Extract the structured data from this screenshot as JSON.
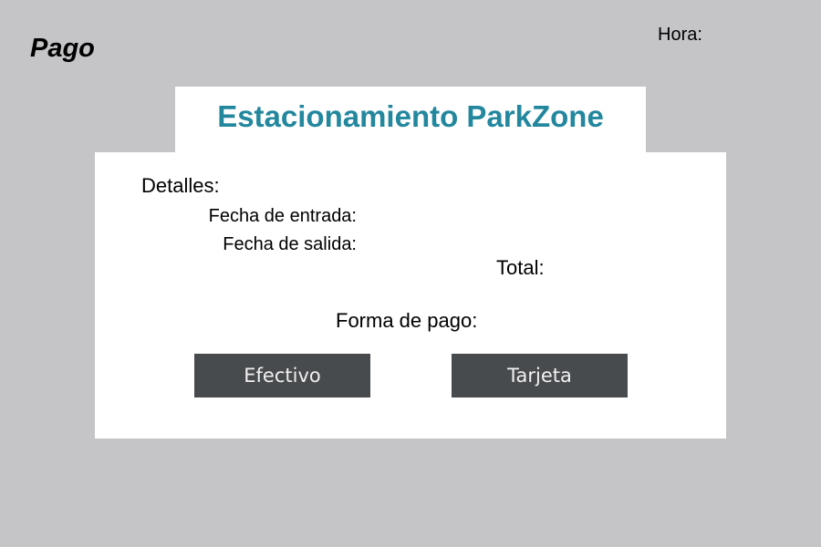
{
  "header": {
    "page_title": "Pago",
    "clock_label": "Hora:"
  },
  "brand": {
    "title": "Estacionamiento ParkZone",
    "accent_color": "#23879e"
  },
  "details": {
    "heading": "Detalles:",
    "entry_date_label": "Fecha de entrada:",
    "exit_date_label": "Fecha de salida:",
    "total_label": "Total:"
  },
  "payment": {
    "label": "Forma de pago:",
    "options": [
      {
        "label": "Efectivo"
      },
      {
        "label": "Tarjeta"
      }
    ],
    "button_color": "#484b4e"
  }
}
